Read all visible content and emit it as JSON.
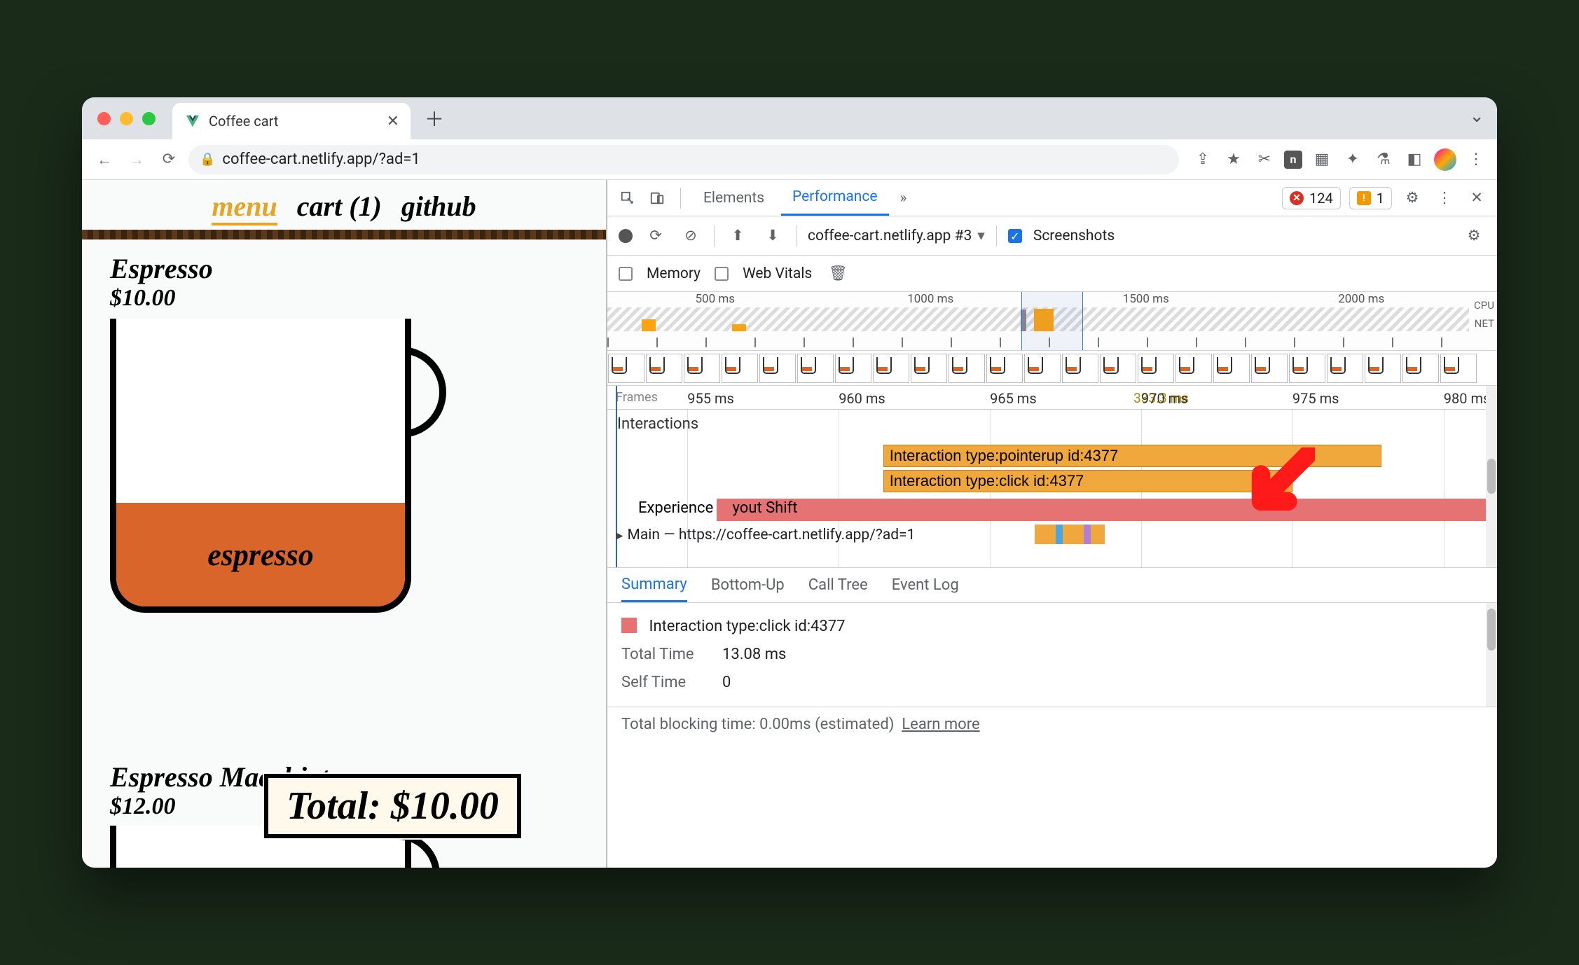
{
  "browser": {
    "tab_title": "Coffee cart",
    "url": "coffee-cart.netlify.app/?ad=1"
  },
  "page": {
    "nav": {
      "menu": "menu",
      "cart": "cart (1)",
      "github": "github"
    },
    "product1": {
      "name": "Espresso",
      "price": "$10.00",
      "fill_label": "espresso"
    },
    "product2": {
      "name": "Espresso Macchiato",
      "price": "$12.00"
    },
    "total_label": "Total: $10.00"
  },
  "devtools": {
    "tabs": {
      "elements": "Elements",
      "performance": "Performance"
    },
    "errors": "124",
    "warnings": "1",
    "recording_select": "coffee-cart.netlify.app #3",
    "screenshots_label": "Screenshots",
    "memory_label": "Memory",
    "webvitals_label": "Web Vitals",
    "overview": {
      "ticks": [
        "500 ms",
        "1000 ms",
        "1500 ms",
        "2000 ms"
      ],
      "cpu": "CPU",
      "net": "NET"
    },
    "ruler": {
      "frames": "Frames",
      "fps": "333.3 ms",
      "ticks": [
        {
          "pos": 9,
          "label": "955 ms"
        },
        {
          "pos": 26,
          "label": "960 ms"
        },
        {
          "pos": 43,
          "label": "965 ms"
        },
        {
          "pos": 60,
          "label": "970 ms"
        },
        {
          "pos": 77,
          "label": "975 ms"
        },
        {
          "pos": 94,
          "label": "980 ms"
        }
      ]
    },
    "tracks": {
      "interactions": "Interactions",
      "bar1": "Interaction type:pointerup id:4377",
      "bar2": "Interaction type:click id:4377",
      "experience": "Experience",
      "layout_shift": "yout Shift",
      "main": "Main — https://coffee-cart.netlify.app/?ad=1"
    },
    "bottom_tabs": {
      "summary": "Summary",
      "bottom_up": "Bottom-Up",
      "call_tree": "Call Tree",
      "event_log": "Event Log"
    },
    "summary": {
      "title": "Interaction type:click id:4377",
      "total_time_k": "Total Time",
      "total_time_v": "13.08 ms",
      "self_time_k": "Self Time",
      "self_time_v": "0"
    },
    "footer": {
      "blocking": "Total blocking time: 0.00ms (estimated)",
      "learn": "Learn more"
    }
  }
}
